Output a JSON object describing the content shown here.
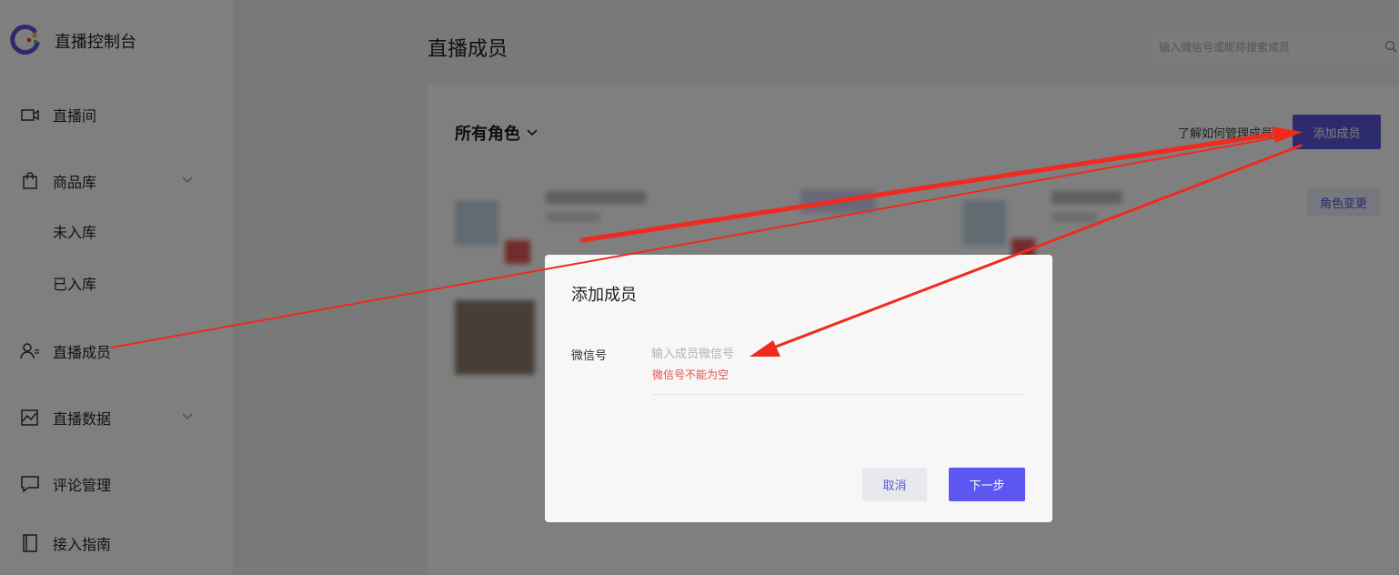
{
  "sidebar": {
    "brand_title": "直播控制台",
    "items": [
      {
        "label": "直播间",
        "icon": "video-camera-icon"
      },
      {
        "label": "商品库",
        "icon": "shopping-bag-icon"
      },
      {
        "label": "未入库"
      },
      {
        "label": "已入库"
      },
      {
        "label": "直播成员",
        "icon": "user-list-icon"
      },
      {
        "label": "直播数据",
        "icon": "chart-icon"
      },
      {
        "label": "评论管理",
        "icon": "comment-icon"
      },
      {
        "label": "接入指南",
        "icon": "book-icon"
      }
    ]
  },
  "header": {
    "title": "直播成员",
    "search_placeholder": "输入微信号或昵称搜索成员"
  },
  "members": {
    "role_filter": "所有角色",
    "help_link": "了解如何管理成员",
    "add_button": "添加成员",
    "role_change_button": "角色变更"
  },
  "dialog": {
    "title": "添加成员",
    "field_label": "微信号",
    "input_placeholder": "输入成员微信号",
    "input_value": "",
    "error": "微信号不能为空",
    "cancel": "取消",
    "next": "下一步"
  },
  "colors": {
    "accent": "#5b57d6",
    "error": "#e0524e",
    "annotation_arrow": "#f02a1e"
  }
}
